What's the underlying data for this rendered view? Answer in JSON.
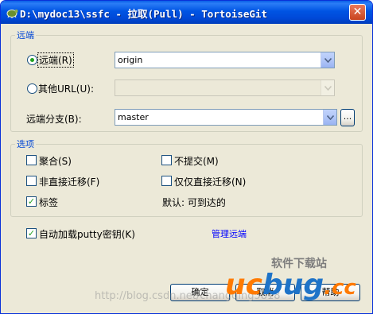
{
  "window": {
    "title": "D:\\mydoc13\\ssfc - 拉取(Pull) - TortoiseGit",
    "close_glyph": "✕"
  },
  "remote_group": {
    "legend": "远端",
    "remote_radio_label": "远端(R)",
    "remote_selected": "origin",
    "other_url_label": "其他URL(U):",
    "other_url_value": "",
    "remote_branch_label": "远端分支(B):",
    "remote_branch_value": "master",
    "browse_label": "..."
  },
  "options_group": {
    "legend": "选项",
    "squash_label": "聚合(S)",
    "no_commit_label": "不提交(M)",
    "no_ff_label": "非直接迁移(F)",
    "ff_only_label": "仅仅直接迁移(N)",
    "tags_label": "标签",
    "tags_checked": true,
    "default_text": "默认: 可到达的"
  },
  "autoload_label": "自动加载putty密钥(K)",
  "autoload_checked": true,
  "manage_remotes_link": "管理远端",
  "buttons": {
    "ok": "确定",
    "cancel": "取消",
    "help": "帮助"
  },
  "watermark": {
    "url": "http://blog.csdn.net/changqing5818",
    "brand_cn": "软件下载站",
    "brand_logo": "ucbug.cc"
  },
  "colors": {
    "titlebar": "#0054e3",
    "legend": "#0046d5",
    "link": "#0000ff",
    "checkmark": "#21a121"
  }
}
